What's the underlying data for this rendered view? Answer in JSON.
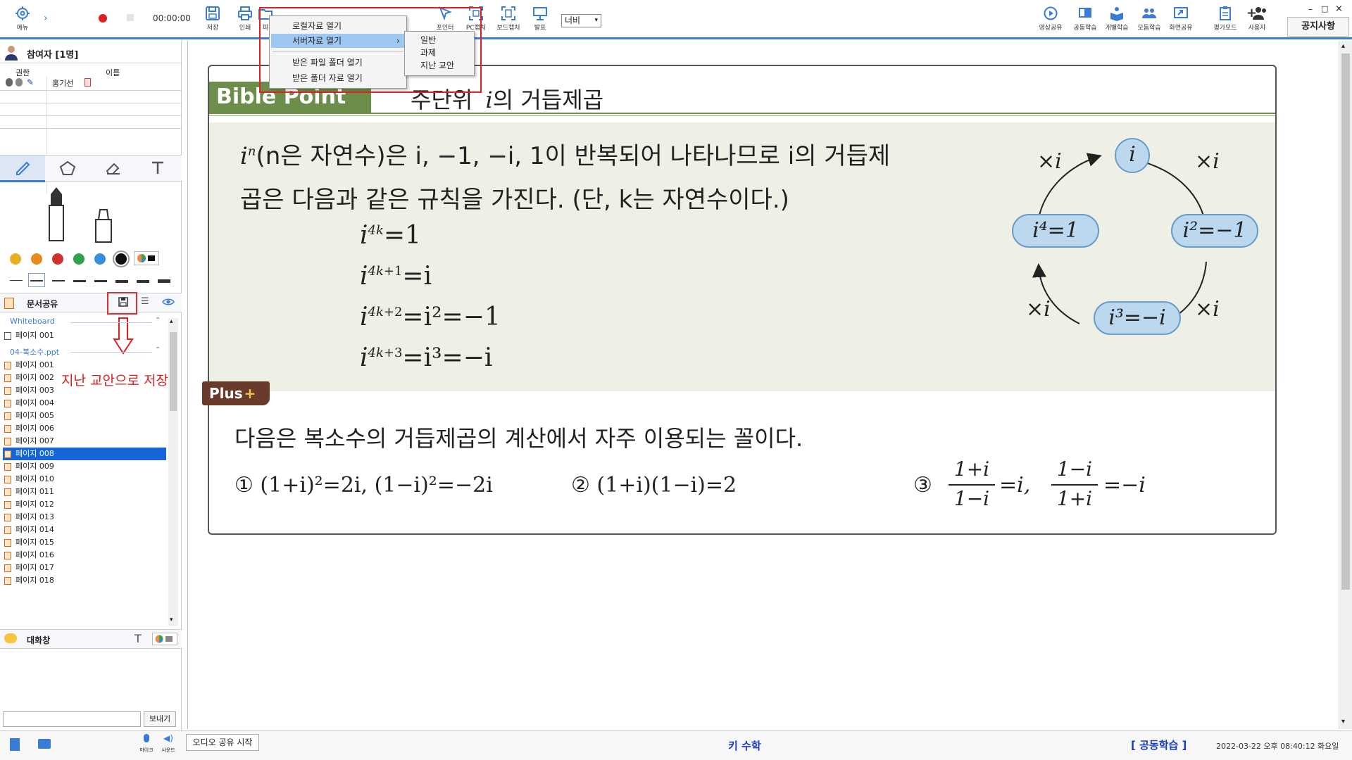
{
  "toolbar": {
    "menu_label": "메뉴",
    "time": "00:00:00",
    "save_label": "저장",
    "print_label": "인쇄",
    "file_label": "파",
    "pointer_label": "포인터",
    "pc_capture_label": "PC캡처",
    "board_capture_label": "보드캡처",
    "present_label": "발표",
    "zoom_select": "너비",
    "right_buttons": [
      "영상공유",
      "공동학습",
      "개별학습",
      "모둠학습",
      "화면공유",
      "평가모드",
      "사용자"
    ],
    "notice_label": "공지사항",
    "window_controls": [
      "–",
      "□",
      "×"
    ]
  },
  "file_menu": {
    "items": [
      "로컬자료 열기",
      "서버자료 열기",
      "받은 파일 폴더 열기",
      "받은 폴더 자료 열기"
    ],
    "submenu_arrow": "›",
    "submenu": [
      "일반",
      "과제",
      "지난 교안"
    ]
  },
  "participants": {
    "title": "참여자 [1명]",
    "col_role": "권한",
    "col_name": "이름",
    "rows": [
      {
        "name": "홍기선"
      }
    ]
  },
  "draw_tools": {
    "colors": [
      "#e8b020",
      "#e88a20",
      "#d03030",
      "#30a050",
      "#3a8ee0",
      "#111111"
    ]
  },
  "doc_share": {
    "title": "문서공유",
    "annotation": "지난 교안으로 저장",
    "group1": "Whiteboard",
    "group1_items": [
      "페이지 001"
    ],
    "group2": "04-복소수.ppt",
    "group2_items": [
      "페이지 001",
      "페이지 002",
      "페이지 003",
      "페이지 004",
      "페이지 005",
      "페이지 006",
      "페이지 007",
      "페이지 008",
      "페이지 009",
      "페이지 010",
      "페이지 011",
      "페이지 012",
      "페이지 013",
      "페이지 014",
      "페이지 015",
      "페이지 016",
      "페이지 017",
      "페이지 018"
    ],
    "selected_index": 7
  },
  "chat": {
    "title": "대화창",
    "send_label": "보내기",
    "input_value": ""
  },
  "status": {
    "mic_label": "마이크",
    "sound_label": "사운드",
    "audio_button": "오디오 공유 시작",
    "center_title": "키 수학",
    "mode": "[ 공동학습 ]",
    "datetime": "2022-03-22 오후 08:40:12 화요일"
  },
  "slide": {
    "badge": "Bible Point",
    "title_visible": "주단위",
    "title_i": "i",
    "title_tail": "의 거듭제곱",
    "intro_line1": "(n은 자연수)은 i, −1, −i, 1이 반복되어 나타나므로 i의 거듭제",
    "intro_line2": "곱은 다음과 같은 규칙을 가진다. (단, k는 자연수이다.)",
    "eq1": "=1",
    "eq2": "=i",
    "eq3": "=i²=−1",
    "eq4": "=i³=−i",
    "cycle_top": "i",
    "cycle_right": "i²=−1",
    "cycle_bottom": "i³=−i",
    "cycle_left": "i⁴=1",
    "cycle_op": "×i",
    "plus_badge": "Plus",
    "plus_text": "다음은 복소수의 거듭제곱의 계산에서 자주 이용되는 꼴이다.",
    "f1": "① (1+i)²=2i, (1−i)²=−2i",
    "f2": "② (1+i)(1−i)=2",
    "f3_num": "③",
    "f3_a_num": "1+i",
    "f3_a_den": "1−i",
    "f3_a_res": "=i,",
    "f3_b_num": "1−i",
    "f3_b_den": "1+i",
    "f3_b_res": "=−i"
  }
}
